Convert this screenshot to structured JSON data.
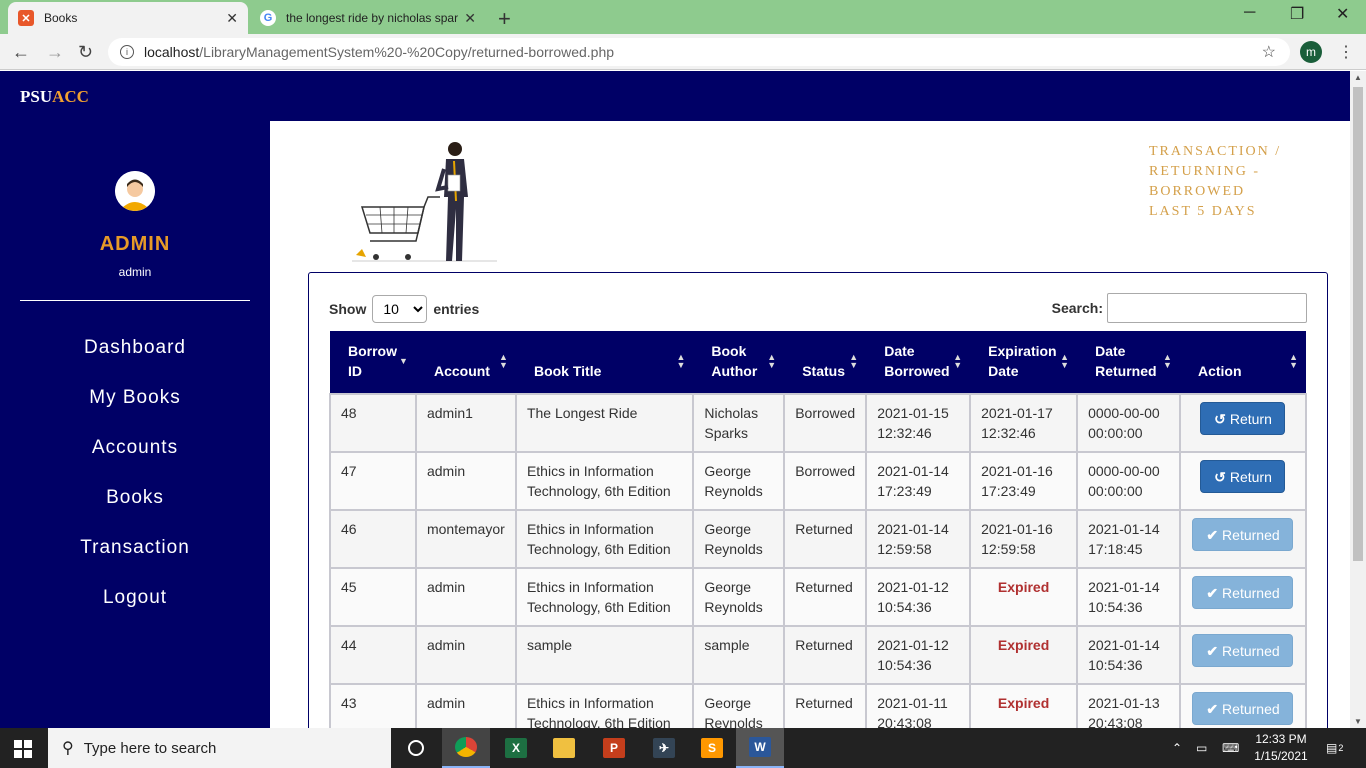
{
  "browser": {
    "tabs": [
      {
        "title": "Books",
        "active": true
      },
      {
        "title": "the longest ride by nicholas spark",
        "active": false
      }
    ],
    "url_host": "localhost",
    "url_path": "/LibraryManagementSystem%20-%20Copy/returned-borrowed.php",
    "profile_initial": "m"
  },
  "brand": {
    "part1": "PSU",
    "part2": "ACC"
  },
  "sidebar": {
    "title": "ADMIN",
    "subtitle": "admin",
    "items": [
      {
        "label": "Dashboard"
      },
      {
        "label": "My Books"
      },
      {
        "label": "Accounts"
      },
      {
        "label": "Books"
      },
      {
        "label": "Transaction"
      },
      {
        "label": "Logout"
      }
    ]
  },
  "breadcrumb": {
    "line1": "TRANSACTION /",
    "line2": "RETURNING -",
    "line3": "BORROWED",
    "line4": "LAST 5 DAYS"
  },
  "table_controls": {
    "show_label": "Show",
    "entries_label": "entries",
    "entries_value": "10",
    "search_label": "Search:"
  },
  "table": {
    "columns": [
      {
        "line1": "Borrow",
        "line2": "ID"
      },
      {
        "line1": "",
        "line2": "Account"
      },
      {
        "line1": "",
        "line2": "Book Title"
      },
      {
        "line1": "Book",
        "line2": "Author"
      },
      {
        "line1": "",
        "line2": "Status"
      },
      {
        "line1": "Date",
        "line2": "Borrowed"
      },
      {
        "line1": "Expiration",
        "line2": "Date"
      },
      {
        "line1": "Date",
        "line2": "Returned"
      },
      {
        "line1": "",
        "line2": "Action"
      }
    ],
    "rows": [
      {
        "id": "48",
        "account": "admin1",
        "title": "The Longest Ride",
        "author": "Nicholas Sparks",
        "status": "Borrowed",
        "borrowed": "2021-01-15 12:32:46",
        "expiration": "2021-01-17 12:32:46",
        "returned": "0000-00-00 00:00:00",
        "action": "Return"
      },
      {
        "id": "47",
        "account": "admin",
        "title": "Ethics in Information Technology, 6th Edition",
        "author": "George Reynolds",
        "status": "Borrowed",
        "borrowed": "2021-01-14 17:23:49",
        "expiration": "2021-01-16 17:23:49",
        "returned": "0000-00-00 00:00:00",
        "action": "Return"
      },
      {
        "id": "46",
        "account": "montemayor",
        "title": "Ethics in Information Technology, 6th Edition",
        "author": "George Reynolds",
        "status": "Returned",
        "borrowed": "2021-01-14 12:59:58",
        "expiration": "2021-01-16 12:59:58",
        "returned": "2021-01-14 17:18:45",
        "action": "Returned"
      },
      {
        "id": "45",
        "account": "admin",
        "title": "Ethics in Information Technology, 6th Edition",
        "author": "George Reynolds",
        "status": "Returned",
        "borrowed": "2021-01-12 10:54:36",
        "expiration": "Expired",
        "returned": "2021-01-14 10:54:36",
        "action": "Returned"
      },
      {
        "id": "44",
        "account": "admin",
        "title": "sample",
        "author": "sample",
        "status": "Returned",
        "borrowed": "2021-01-12 10:54:36",
        "expiration": "Expired",
        "returned": "2021-01-14 10:54:36",
        "action": "Returned"
      },
      {
        "id": "43",
        "account": "admin",
        "title": "Ethics in Information Technology, 6th Edition",
        "author": "George Reynolds",
        "status": "Returned",
        "borrowed": "2021-01-11 20:43:08",
        "expiration": "Expired",
        "returned": "2021-01-13 20:43:08",
        "action": "Returned"
      }
    ]
  },
  "taskbar": {
    "search_placeholder": "Type here to search",
    "time": "12:33 PM",
    "date": "1/15/2021",
    "notification_count": "2"
  },
  "colors": {
    "navy": "#000066",
    "accent": "#e69a28",
    "return_btn": "#2e6db4",
    "returned_btn": "#85b3da",
    "expired": "#b03030"
  }
}
